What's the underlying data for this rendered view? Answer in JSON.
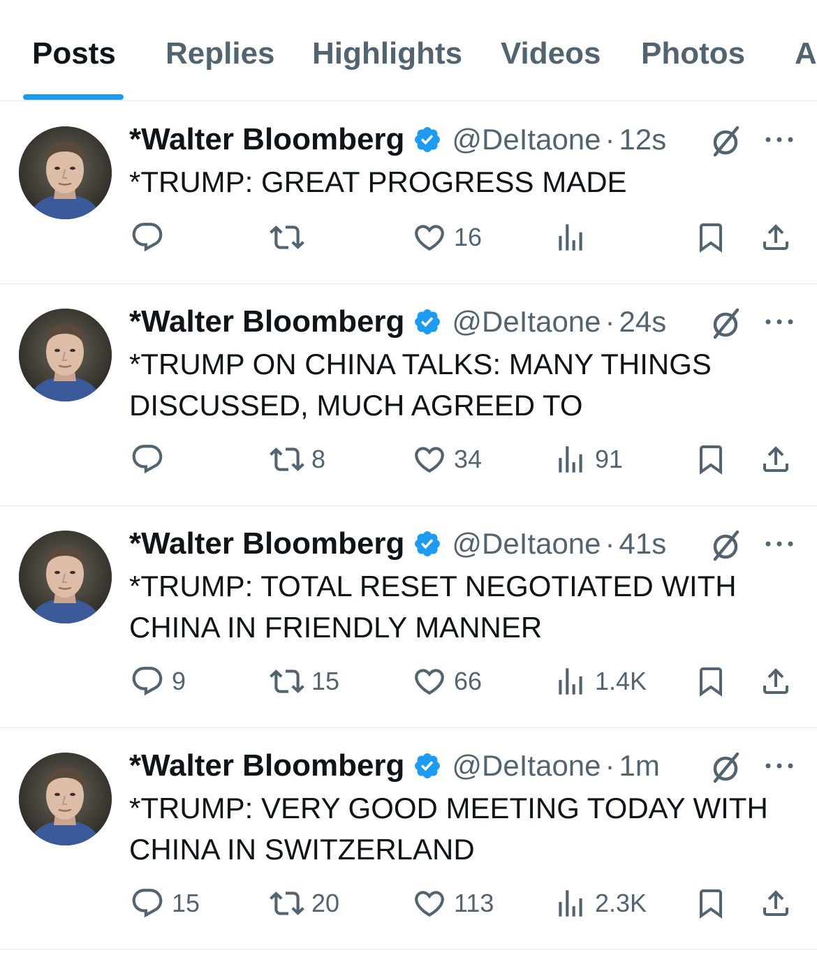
{
  "tabs": [
    {
      "label": "Posts",
      "active": true
    },
    {
      "label": "Replies",
      "active": false
    },
    {
      "label": "Highlights",
      "active": false
    },
    {
      "label": "Videos",
      "active": false
    },
    {
      "label": "Photos",
      "active": false
    },
    {
      "label": "A",
      "active": false
    }
  ],
  "colors": {
    "accent": "#1d9bf0",
    "text_primary": "#0f1419",
    "text_secondary": "#536471",
    "divider": "#e6e9ec"
  },
  "icons": [
    "reply-icon",
    "repost-icon",
    "like-icon",
    "views-icon",
    "bookmark-icon",
    "share-icon",
    "verified-badge-icon",
    "grok-icon",
    "more-icon"
  ],
  "posts": [
    {
      "author": "*Walter Bloomberg",
      "handle": "@DeItaone",
      "separator": "·",
      "time": "12s",
      "text": "*TRUMP: GREAT PROGRESS MADE",
      "replies": "",
      "reposts": "",
      "likes": "16",
      "views": ""
    },
    {
      "author": "*Walter Bloomberg",
      "handle": "@DeItaone",
      "separator": "·",
      "time": "24s",
      "text": "*TRUMP ON CHINA TALKS: MANY THINGS DISCUSSED, MUCH AGREED TO",
      "replies": "",
      "reposts": "8",
      "likes": "34",
      "views": "91"
    },
    {
      "author": "*Walter Bloomberg",
      "handle": "@DeItaone",
      "separator": "·",
      "time": "41s",
      "text": "*TRUMP: TOTAL RESET NEGOTIATED WITH CHINA IN FRIENDLY MANNER",
      "replies": "9",
      "reposts": "15",
      "likes": "66",
      "views": "1.4K"
    },
    {
      "author": "*Walter Bloomberg",
      "handle": "@DeItaone",
      "separator": "·",
      "time": "1m",
      "text": "*TRUMP: VERY GOOD MEETING TODAY WITH CHINA IN SWITZERLAND",
      "replies": "15",
      "reposts": "20",
      "likes": "113",
      "views": "2.3K"
    }
  ]
}
